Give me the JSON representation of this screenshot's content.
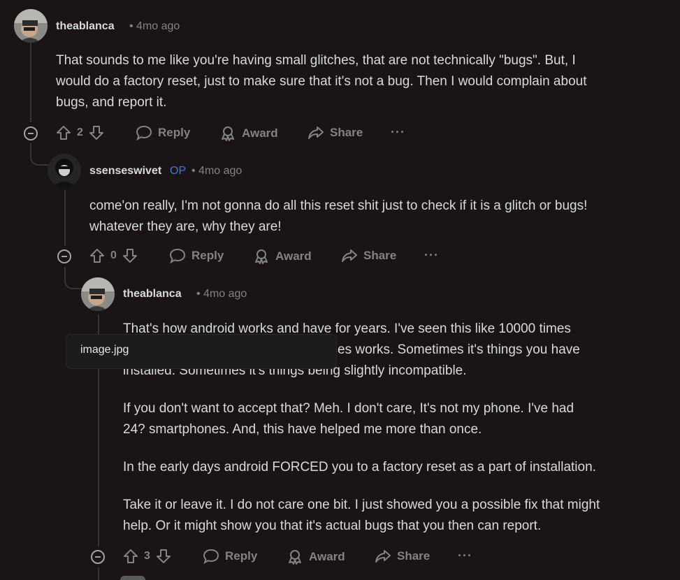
{
  "comments": [
    {
      "username": "theablanca",
      "meta": "• 4mo ago",
      "body": [
        "That sounds to me like you're having small glitches, that are not technically \"bugs\". But, I",
        "would do a factory reset, just to make sure that it's not a bug. Then I would complain about",
        "bugs, and report it."
      ],
      "votes": "2"
    },
    {
      "username": "ssenseswivet",
      "op": "OP",
      "meta": "• 4mo ago",
      "body": [
        "come'on really, I'm not gonna do all this reset shit just to check if it is a glitch or bugs!",
        "whatever they are, why they are!"
      ],
      "votes": "0"
    },
    {
      "username": "theablanca",
      "meta": "• 4mo ago",
      "body": [
        "That's how android works and have for years. I've seen this like 10000 times",
        "es works. Sometimes it's things you have",
        "installed. Sometimes it's things being slightly incompatible.",
        "If you don't want to accept that? Meh. I don't care, It's not my phone. I've had",
        "24? smartphones. And, this have helped me more than once.",
        "In the early days android FORCED you to a factory reset as a part of installation.",
        "Take it or leave it. I do not care one bit. I just showed you a possible fix that might",
        "help. Or it might show you that it's actual bugs that you then can report."
      ],
      "votes": "3"
    }
  ],
  "actions": {
    "reply": "Reply",
    "award": "Award",
    "share": "Share",
    "more": "···"
  },
  "tooltip": {
    "label": "image.jpg"
  },
  "colors": {
    "background": "#1a1416",
    "text": "#d7dadc",
    "muted": "#818384",
    "op": "#3d7bd9",
    "thread_line": "#343536"
  },
  "icons": [
    "upvote-icon",
    "downvote-icon",
    "reply-bubble-icon",
    "award-icon",
    "share-icon",
    "collapse-icon",
    "more-icon"
  ]
}
